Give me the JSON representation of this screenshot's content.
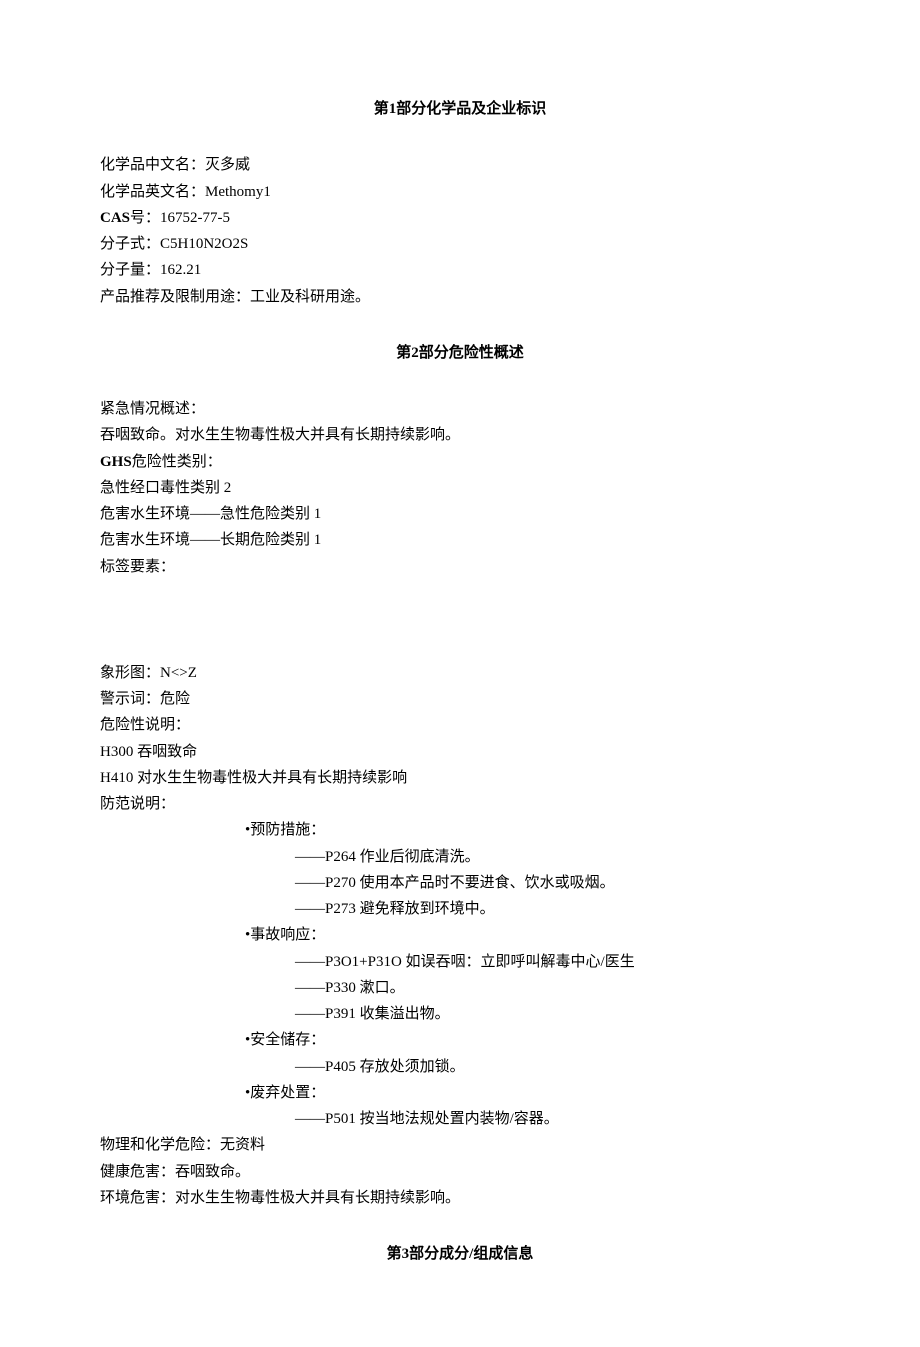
{
  "section1": {
    "title_prefix": "第",
    "title_num": "1",
    "title_suffix": "部分化学品及企业标识",
    "name_zh_label": "化学品中文名：",
    "name_zh_value": "灭多威",
    "name_en_label": "化学品英文名：",
    "name_en_value": "Methomy1",
    "cas_label_pre": "CAS",
    "cas_label_post": "号：",
    "cas_value": "16752-77-5",
    "formula_label": "分子式：",
    "formula_value": "C5H10N2O2S",
    "mw_label": "分子量：",
    "mw_value": "162.21",
    "usage_label": "产品推荐及限制用途：",
    "usage_value": "工业及科研用途。"
  },
  "section2": {
    "title_prefix": "第",
    "title_num": "2",
    "title_suffix": "部分危险性概述",
    "emergency_label": "紧急情况概述：",
    "emergency_text": "吞咽致命。对水生生物毒性极大并具有长期持续影响。",
    "ghs_label_pre": "GHS",
    "ghs_label_post": "危险性类别：",
    "ghs_cat1": "急性经口毒性类别 2",
    "ghs_cat2": "危害水生环境——急性危险类别 1",
    "ghs_cat3": "危害水生环境——长期危险类别 1",
    "label_elements": "标签要素：",
    "pictogram_label": "象形图：",
    "pictogram_value": "N<>Z",
    "signal_label": "警示词：",
    "signal_value": "危险",
    "hazard_stmt_label": "危险性说明：",
    "h300": "H300 吞咽致命",
    "h410": "H410 对水生生物毒性极大并具有长期持续影响",
    "precaution_label": "防范说明：",
    "prevent_header": "•预防措施：",
    "p264": "——P264 作业后彻底清洗。",
    "p270": "——P270 使用本产品时不要进食、饮水或吸烟。",
    "p273": "——P273 避免释放到环境中。",
    "response_header": "•事故响应：",
    "p301": "——P3O1+P31O 如误吞咽：立即呼叫解毒中心/医生",
    "p330": "——P330 漱口。",
    "p391": "——P391 收集溢出物。",
    "storage_header": "•安全储存：",
    "p405": "——P405 存放处须加锁。",
    "disposal_header": "•废弃处置：",
    "p501": "——P501 按当地法规处置内装物/容器。",
    "phys_label": "物理和化学危险：",
    "phys_value": "无资料",
    "health_label": "健康危害：",
    "health_value": "吞咽致命。",
    "env_label": "环境危害：",
    "env_value": "对水生生物毒性极大并具有长期持续影响。"
  },
  "section3": {
    "title_prefix": "第",
    "title_num": "3",
    "title_suffix": "部分成分/组成信息"
  }
}
